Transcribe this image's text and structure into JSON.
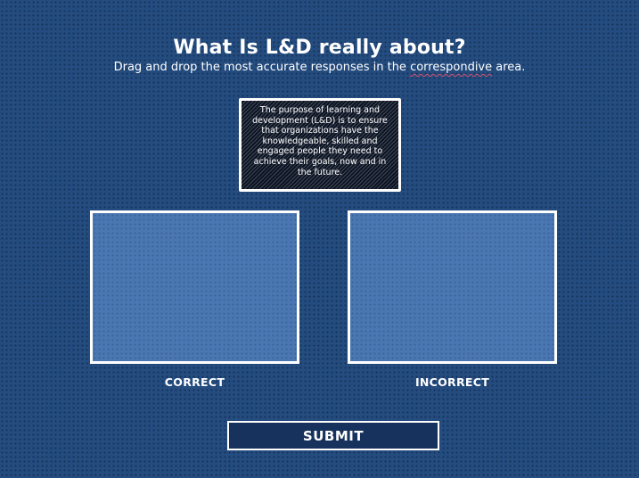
{
  "header": {
    "title": "What Is L&D really about?",
    "subtitle_before": "Drag and drop the most accurate responses in the ",
    "subtitle_highlight": "correspondive",
    "subtitle_after": " area."
  },
  "drag_item": {
    "text": "The purpose of learning and development (L&D) is to ensure that organizations have the knowledgeable, skilled and engaged people they need to achieve their goals, now and in the future."
  },
  "drop_zones": [
    {
      "label": "CORRECT"
    },
    {
      "label": "INCORRECT"
    }
  ],
  "submit": {
    "label": "SUBMIT"
  },
  "colors": {
    "background": "#244c7f",
    "drop_zone": "#4a77b1",
    "card": "#0c1424",
    "button": "#17325c",
    "border": "#ffffff"
  }
}
